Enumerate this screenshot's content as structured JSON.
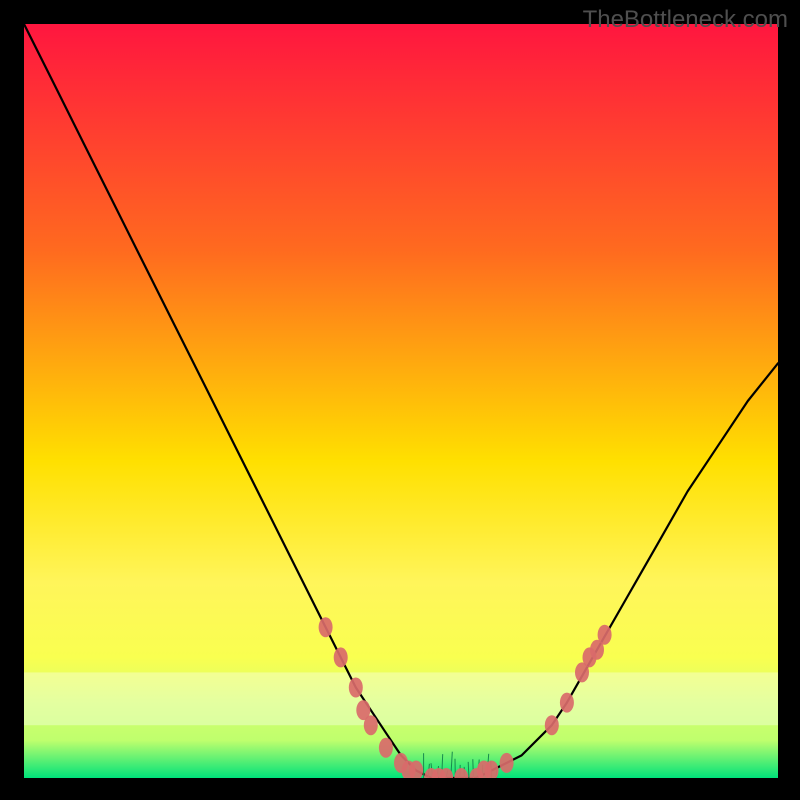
{
  "watermark": "TheBottleneck.com",
  "chart_data": {
    "type": "line",
    "title": "",
    "xlabel": "",
    "ylabel": "",
    "xlim": [
      0,
      100
    ],
    "ylim": [
      0,
      100
    ],
    "background_gradient": {
      "top": "#ff163f",
      "upper_mid": "#ffa600",
      "mid": "#ffe000",
      "lower": "#f9ff50",
      "lower2": "#bfff6d",
      "bottom": "#00e27a"
    },
    "series": [
      {
        "name": "bottleneck-curve",
        "color": "#000000",
        "x": [
          0,
          4,
          8,
          12,
          16,
          20,
          24,
          28,
          32,
          36,
          40,
          44,
          48,
          50,
          52,
          54,
          56,
          58,
          60,
          62,
          66,
          70,
          72,
          76,
          80,
          84,
          88,
          92,
          96,
          100
        ],
        "y": [
          100,
          92,
          84,
          76,
          68,
          60,
          52,
          44,
          36,
          28,
          20,
          12,
          6,
          3,
          1,
          0,
          0,
          0,
          0,
          1,
          3,
          7,
          10,
          17,
          24,
          31,
          38,
          44,
          50,
          55
        ]
      }
    ],
    "markers": {
      "name": "highlight-points",
      "color": "#d96a6a",
      "points": [
        {
          "x": 40,
          "y": 20
        },
        {
          "x": 42,
          "y": 16
        },
        {
          "x": 44,
          "y": 12
        },
        {
          "x": 45,
          "y": 9
        },
        {
          "x": 46,
          "y": 7
        },
        {
          "x": 48,
          "y": 4
        },
        {
          "x": 50,
          "y": 2
        },
        {
          "x": 51,
          "y": 1
        },
        {
          "x": 52,
          "y": 1
        },
        {
          "x": 54,
          "y": 0
        },
        {
          "x": 55,
          "y": 0
        },
        {
          "x": 56,
          "y": 0
        },
        {
          "x": 58,
          "y": 0
        },
        {
          "x": 60,
          "y": 0
        },
        {
          "x": 61,
          "y": 1
        },
        {
          "x": 62,
          "y": 1
        },
        {
          "x": 64,
          "y": 2
        },
        {
          "x": 70,
          "y": 7
        },
        {
          "x": 72,
          "y": 10
        },
        {
          "x": 74,
          "y": 14
        },
        {
          "x": 75,
          "y": 16
        },
        {
          "x": 76,
          "y": 17
        },
        {
          "x": 77,
          "y": 19
        }
      ]
    }
  }
}
